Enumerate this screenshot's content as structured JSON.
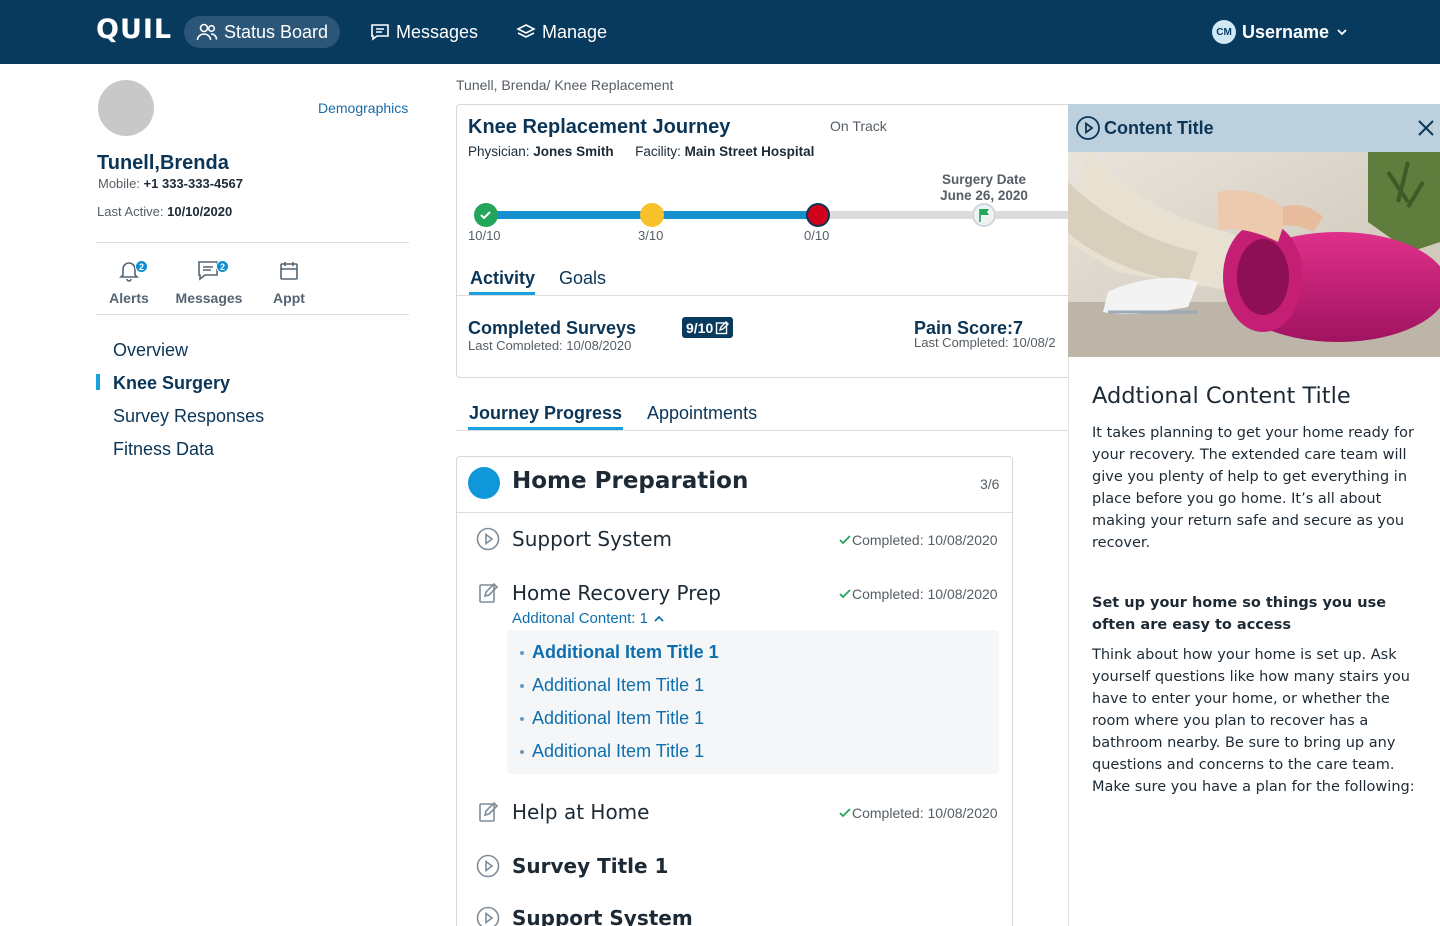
{
  "app": {
    "logo": "QUIL"
  },
  "topnav": {
    "items": [
      {
        "label": "Status Board",
        "icon": "users-icon"
      },
      {
        "label": "Messages",
        "icon": "message-icon"
      },
      {
        "label": "Manage",
        "icon": "layers-icon"
      }
    ],
    "user": {
      "initials": "CM",
      "name": "Username"
    }
  },
  "patient": {
    "demographics_link": "Demographics",
    "name": "Tunell,Brenda",
    "mobile_label": "Mobile:",
    "mobile": "+1 333-333-4567",
    "last_active_label": "Last Active:",
    "last_active": "10/10/2020"
  },
  "quick_actions": [
    {
      "label": "Alerts",
      "badge": "2",
      "icon": "bell-icon"
    },
    {
      "label": "Messages",
      "badge": "2",
      "icon": "message-icon"
    },
    {
      "label": "Appt",
      "badge": "",
      "icon": "calendar-icon"
    }
  ],
  "side_nav": {
    "items": [
      "Overview",
      "Knee Surgery",
      "Survey Responses",
      "Fitness Data"
    ],
    "active": "Knee Surgery"
  },
  "breadcrumb": "Tunell, Brenda/ Knee Replacement",
  "journey": {
    "title": "Knee Replacement Journey",
    "status": "On Track",
    "physician_label": "Physician:",
    "physician": "Jones Smith",
    "facility_label": "Facility:",
    "facility": "Main Street Hospital",
    "surgery_label": "Surgery Date",
    "surgery_date": "June 26, 2020",
    "milestones": [
      {
        "label": "10/10",
        "status": "complete",
        "color": "#23a55a"
      },
      {
        "label": "3/10",
        "status": "warning",
        "color": "#f7c12b"
      },
      {
        "label": "0/10",
        "status": "alert",
        "color": "#d0021b"
      }
    ],
    "tabs": [
      "Activity",
      "Goals"
    ],
    "active_tab": "Activity",
    "completed_surveys_title": "Completed Surveys",
    "completed_surveys_badge": "9/10",
    "completed_surveys_last": "Last Completed: 10/08/2020",
    "pain_title": "Pain Score:7",
    "pain_last": "Last Completed: 10/08/2"
  },
  "progress_tabs": [
    "Journey Progress",
    "Appointments"
  ],
  "progress_active_tab": "Journey Progress",
  "section": {
    "title": "Home Preparation",
    "count": "3/6"
  },
  "section_items": [
    {
      "title": "Support System",
      "icon": "play-circle-icon",
      "completed": "Completed: 10/08/2020"
    },
    {
      "title": "Home Recovery Prep",
      "icon": "edit-icon",
      "completed": "Completed: 10/08/2020",
      "additional": "Additonal Content: 1"
    },
    {
      "title": "Help at Home",
      "icon": "edit-icon",
      "completed": "Completed: 10/08/2020"
    },
    {
      "title": "Survey Title 1",
      "icon": "play-circle-icon",
      "completed": ""
    },
    {
      "title": "Support System",
      "icon": "play-circle-icon",
      "completed": ""
    }
  ],
  "additional_items": [
    "Additional Item Title 1",
    "Additional Item Title 1",
    "Additional Item Title 1",
    "Additional Item Title 1"
  ],
  "drawer": {
    "title": "Content Title",
    "heading": "Addtional Content Title",
    "intro": "It takes planning to get your home ready for your recovery. The extended care team will give you plenty of help to get everything in place before you go home. It’s all about making your return safe and secure as you recover.",
    "subheading": "Set up your home so things you use often are easy to access",
    "body": "Think about how your home is set up. Ask yourself questions like how many stairs you have to enter your home, or whether the room where you plan to recover has a bathroom nearby. Be sure to bring up any questions and concerns to the care team. Make sure you have a plan for the following:"
  },
  "colors": {
    "navy": "#083a5e",
    "accent": "#1ba1e2",
    "track": "#1590cf",
    "link": "#1b6ca8",
    "success": "#23a55a"
  }
}
